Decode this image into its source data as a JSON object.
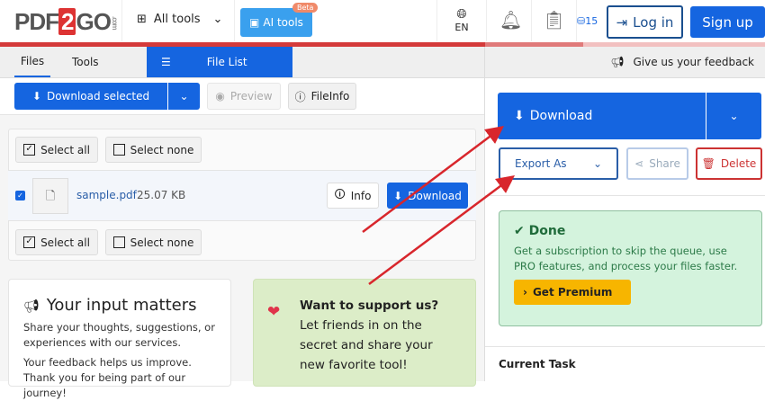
{
  "header": {
    "logo": "PDF2GO.com",
    "logo_parts": [
      "PDF",
      "2",
      "GO",
      ".com"
    ],
    "all_tools": "All tools",
    "ai_tools": "AI tools",
    "beta": "Beta",
    "lang": "EN",
    "credits": "15",
    "login": "Log in",
    "signup": "Sign up"
  },
  "tabs": {
    "files": "Files",
    "tools": "Tools",
    "file_list": "File List"
  },
  "feedback_bar": "Give us your feedback",
  "toolbar": {
    "download_selected": "Download selected",
    "preview": "Preview",
    "fileinfo": "FileInfo"
  },
  "files": {
    "select_all": "Select all",
    "select_none": "Select none",
    "items": [
      {
        "name": "sample.pdf",
        "size": "25.07 KB",
        "info": "Info",
        "download": "Download"
      }
    ]
  },
  "input_card": {
    "title": "Your input matters",
    "p1": "Share your thoughts, suggestions, or experiences with our services.",
    "p2": "Your feedback helps us improve. Thank you for being part of our journey!"
  },
  "support_card": {
    "title": "Want to support us?",
    "text": "Let friends in on the secret and share your new favorite tool!"
  },
  "right": {
    "download": "Download",
    "export_as": "Export As",
    "share": "Share",
    "delete": "Delete",
    "done_title": "Done",
    "done_text": "Get a subscription to skip the queue, use PRO features, and process your files faster.",
    "premium": "Get Premium",
    "current_task": "Current Task"
  },
  "colors": {
    "brand_blue": "#1565e0",
    "red": "#d33a3a",
    "green_bg": "#d4f3dd",
    "yellow": "#f7b500"
  }
}
